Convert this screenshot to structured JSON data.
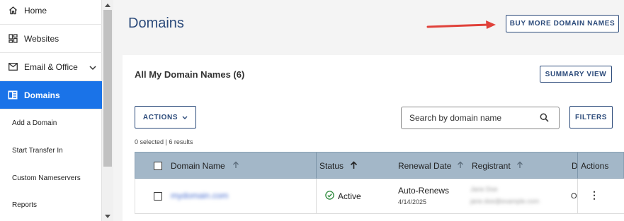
{
  "sidebar": {
    "items": [
      {
        "label": "Home",
        "icon": "home-icon"
      },
      {
        "label": "Websites",
        "icon": "websites-icon"
      },
      {
        "label": "Email & Office",
        "icon": "mail-icon"
      },
      {
        "label": "Domains",
        "icon": "domains-icon"
      }
    ],
    "subitems": [
      "Add a Domain",
      "Start Transfer In",
      "Custom Nameservers",
      "Reports"
    ]
  },
  "main": {
    "title": "Domains",
    "buy_button": "BUY MORE DOMAIN NAMES",
    "card_title": "All My Domain Names (6)",
    "summary_button": "SUMMARY VIEW",
    "actions_button": "ACTIONS",
    "search": {
      "placeholder": "Search by domain name"
    },
    "filters_button": "FILTERS",
    "selection_text": "0 selected | 6 results"
  },
  "table": {
    "headers": {
      "domain_name": "Domain Name",
      "status": "Status",
      "renewal_date": "Renewal Date",
      "registrant": "Registrant",
      "truncated": "D",
      "actions": "Actions"
    },
    "rows": [
      {
        "domain_name": "mydomain.com",
        "status": "Active",
        "renewal_label": "Auto-Renews",
        "renewal_date": "4/14/2025",
        "registrant_name": "Jane Doe",
        "registrant_email": "jane.doe@example.com",
        "truncated": "O",
        "actions": "⋮"
      }
    ]
  },
  "colors": {
    "accent": "#1a73e8",
    "primary_text": "#2b4a7a",
    "header_bg": "#a3b7c8",
    "arrow": "#e0413a",
    "active_green": "#2e8b3d"
  }
}
